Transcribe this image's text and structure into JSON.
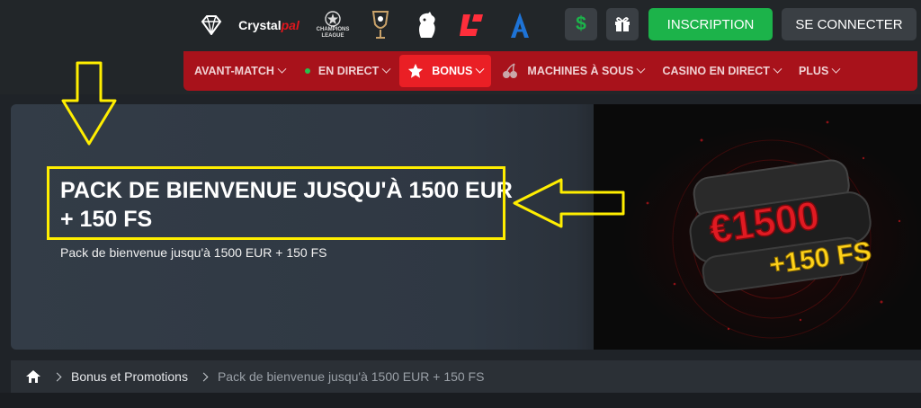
{
  "header": {
    "partners": [
      {
        "name": "crystal-palace",
        "text": "Crystal",
        "accent_text": "pal"
      },
      {
        "name": "champions-league",
        "text": "CHAMPIONS LEAGUE"
      },
      {
        "name": "europa-league",
        "text": ""
      },
      {
        "name": "premier-league",
        "text": ""
      },
      {
        "name": "laliga",
        "text": ""
      },
      {
        "name": "atalanta",
        "text": ""
      }
    ],
    "deposit_icon": "dollar-icon",
    "gift_icon": "gift-icon",
    "signup_label": "INSCRIPTION",
    "login_label": "SE CONNECTER",
    "colors": {
      "signup": "#1cb34a",
      "nav": "#a8121b",
      "nav_active": "#ea1f25",
      "highlight": "#ffee00"
    }
  },
  "nav": {
    "items": [
      {
        "label": "AVANT-MATCH"
      },
      {
        "label": "EN DIRECT"
      },
      {
        "label": "BONUS"
      },
      {
        "label": "MACHINES À SOUS"
      },
      {
        "label": "CASINO EN DIRECT"
      },
      {
        "label": "PLUS"
      }
    ]
  },
  "hero": {
    "title": "PACK DE BIENVENUE JUSQU'À 1500 EUR + 150 FS",
    "subtitle": "Pack de bienvenue jusqu'à 1500 EUR + 150 FS",
    "art_amount": "€1500",
    "art_spins": "+150 FS"
  },
  "breadcrumb": {
    "home_icon": "home-icon",
    "items": [
      "Bonus et Promotions",
      "Pack de bienvenue jusqu'à 1500 EUR + 150 FS"
    ]
  }
}
